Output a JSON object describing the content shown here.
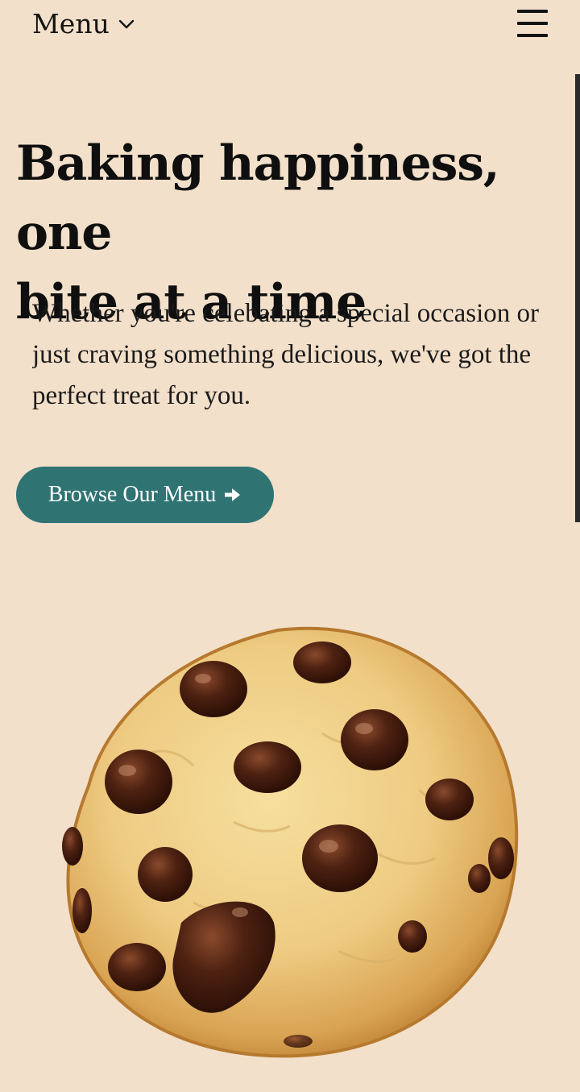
{
  "nav": {
    "menu_label": "Menu"
  },
  "hero": {
    "headline_line1": "Baking happiness, one",
    "headline_line2": "bite at a time",
    "lede_line1": "Whether you're celebating a special occasion or",
    "lede_line2": "just craving something delicious, we've got the",
    "lede_line3": "perfect treat for you.",
    "cta_label": "Browse Our Menu"
  },
  "colors": {
    "background": "#f3e0ca",
    "cta": "#2f7373",
    "text": "#141414"
  },
  "icons": {
    "menu_chevron": "chevron-down-icon",
    "hamburger": "hamburger-menu-icon",
    "cta_arrow": "arrow-right-icon",
    "hero_image": "chocolate-chip-cookie-image"
  }
}
